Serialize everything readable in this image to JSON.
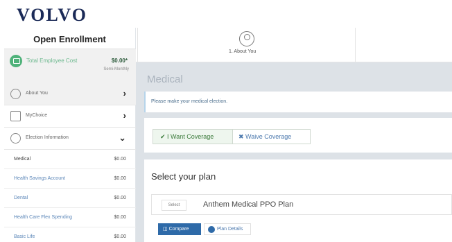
{
  "brand": {
    "logo": "VOLVO"
  },
  "sidebar": {
    "title": "Open Enrollment",
    "cost": {
      "label": "Total Employee Cost",
      "value": "$0.00*",
      "period": "Semi-Monthly"
    },
    "nav": [
      {
        "label": "About You",
        "icon": "person-circle-icon",
        "arrow": "›"
      },
      {
        "label": "MyChoice",
        "icon": "calendar-icon",
        "arrow": "›"
      },
      {
        "label": "Election Information",
        "icon": "check-circle-icon",
        "arrow": "⌄"
      }
    ],
    "elections": [
      {
        "label": "Medical",
        "amount": "$0.00"
      },
      {
        "label": "Health Savings Account",
        "amount": "$0.00"
      },
      {
        "label": "Dental",
        "amount": "$0.00"
      },
      {
        "label": "Health Care Flex Spending",
        "amount": "$0.00"
      },
      {
        "label": "Basic Life",
        "amount": "$0.00"
      }
    ]
  },
  "steps": {
    "current": "1. About You"
  },
  "main": {
    "section_title": "Medical",
    "instruction": "Please make your medical election.",
    "coverage": {
      "want": "I Want Coverage",
      "waive": "Waive Coverage"
    },
    "plan": {
      "heading": "Select your plan",
      "select_label": "Select",
      "name": "Anthem Medical PPO Plan",
      "compare_label": "Compare",
      "details_label": "Plan Details"
    }
  },
  "colors": {
    "brand": "#1b2a57",
    "accent": "#2e6aa8",
    "success": "#4fb27a"
  }
}
